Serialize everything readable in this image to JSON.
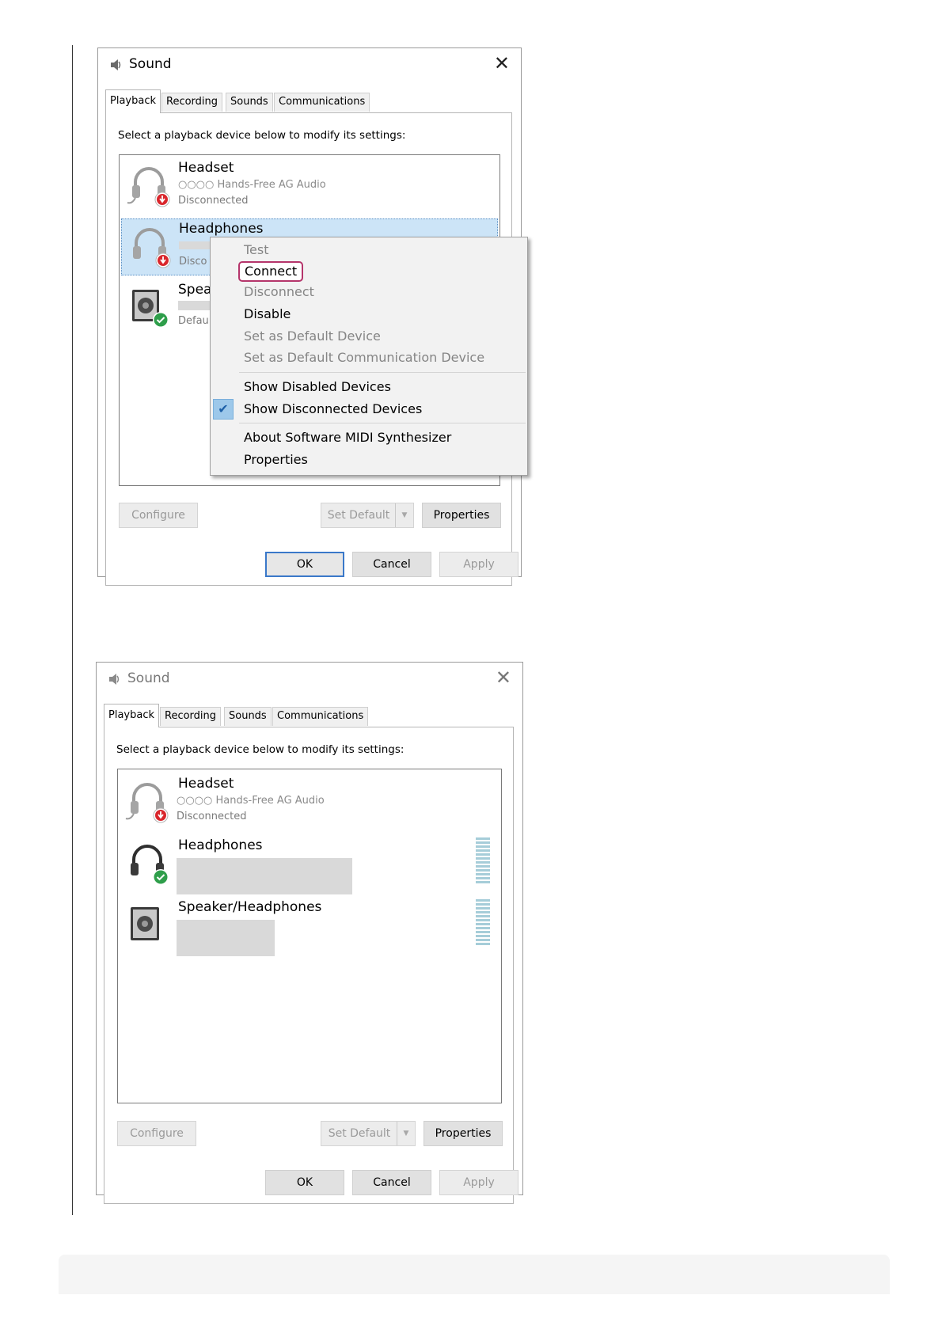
{
  "dialog1": {
    "title": "Sound",
    "tabs": [
      "Playback",
      "Recording",
      "Sounds",
      "Communications"
    ],
    "instruction": "Select a playback device below to modify its settings:",
    "devices": [
      {
        "name": "Headset",
        "subtitle": "○○○○ Hands-Free AG Audio",
        "status": "Disconnected",
        "icon": "headset-disconnected-icon"
      },
      {
        "name": "Headphones",
        "status": "Disco",
        "icon": "headphones-disconnected-icon"
      },
      {
        "name": "Spea",
        "status": "Defau",
        "icon": "speaker-default-icon"
      }
    ],
    "buttons": {
      "configure": "Configure",
      "set_default": "Set Default",
      "properties": "Properties",
      "ok": "OK",
      "cancel": "Cancel",
      "apply": "Apply"
    },
    "context_menu": {
      "test": "Test",
      "connect": "Connect",
      "disconnect": "Disconnect",
      "disable": "Disable",
      "set_default_device": "Set as Default Device",
      "set_default_comm": "Set as Default Communication Device",
      "show_disabled": "Show Disabled Devices",
      "show_disconnected": "Show Disconnected Devices",
      "about_midi": "About Software MIDI Synthesizer",
      "properties": "Properties"
    }
  },
  "dialog2": {
    "title": "Sound",
    "tabs": [
      "Playback",
      "Recording",
      "Sounds",
      "Communications"
    ],
    "instruction": "Select a playback device below to modify its settings:",
    "devices": [
      {
        "name": "Headset",
        "subtitle": "○○○○ Hands-Free AG Audio",
        "status": "Disconnected",
        "icon": "headset-disconnected-icon"
      },
      {
        "name": "Headphones",
        "icon": "headphones-connected-icon"
      },
      {
        "name": "Speaker/Headphones",
        "icon": "speaker-icon"
      }
    ],
    "buttons": {
      "configure": "Configure",
      "set_default": "Set Default",
      "properties": "Properties",
      "ok": "OK",
      "cancel": "Cancel",
      "apply": "Apply"
    }
  },
  "colors": {
    "selection": "#cce4f7",
    "highlight_border": "#b5356b",
    "check_badge": "#2e9e4a",
    "disconnect_badge": "#d9262c",
    "primary_border": "#3a78c9"
  }
}
